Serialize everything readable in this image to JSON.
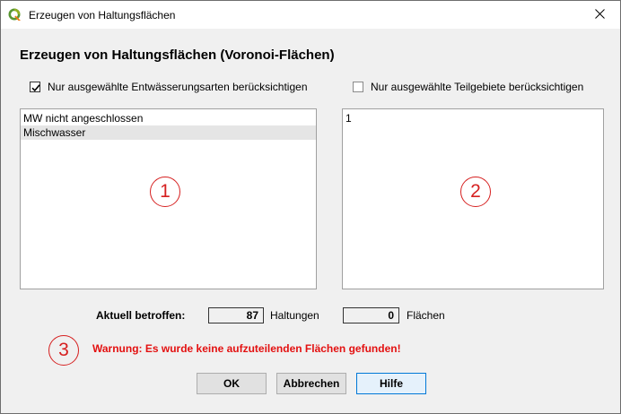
{
  "window": {
    "title": "Erzeugen von Haltungsflächen",
    "close_glyph": "✕",
    "app_icon": "qgis-icon"
  },
  "dialog": {
    "heading": "Erzeugen von Haltungsflächen (Voronoi-Flächen)",
    "checkbox_entwaesserung": {
      "label": "Nur ausgewählte Entwässerungsarten berücksichtigen",
      "checked": true
    },
    "checkbox_teilgebiete": {
      "label": "Nur ausgewählte Teilgebiete berücksichtigen",
      "checked": false
    },
    "entwaesserungsarten_list": {
      "items": [
        {
          "label": "MW nicht angeschlossen",
          "selected": false
        },
        {
          "label": "Mischwasser",
          "selected": true
        }
      ]
    },
    "teilgebiete_list": {
      "items": [
        {
          "label": "1",
          "selected": false
        }
      ]
    },
    "markers": {
      "one": "1",
      "two": "2",
      "three": "3",
      "color": "#d62020"
    },
    "counts": {
      "label": "Aktuell betroffen:",
      "haltungen_value": "87",
      "haltungen_label": "Haltungen",
      "flaechen_value": "0",
      "flaechen_label": "Flächen"
    },
    "warning": {
      "text": "Warnung: Es wurde keine aufzuteilenden Flächen gefunden!",
      "color": "#e31010"
    },
    "buttons": {
      "ok": "OK",
      "cancel": "Abbrechen",
      "help": "Hilfe"
    }
  }
}
